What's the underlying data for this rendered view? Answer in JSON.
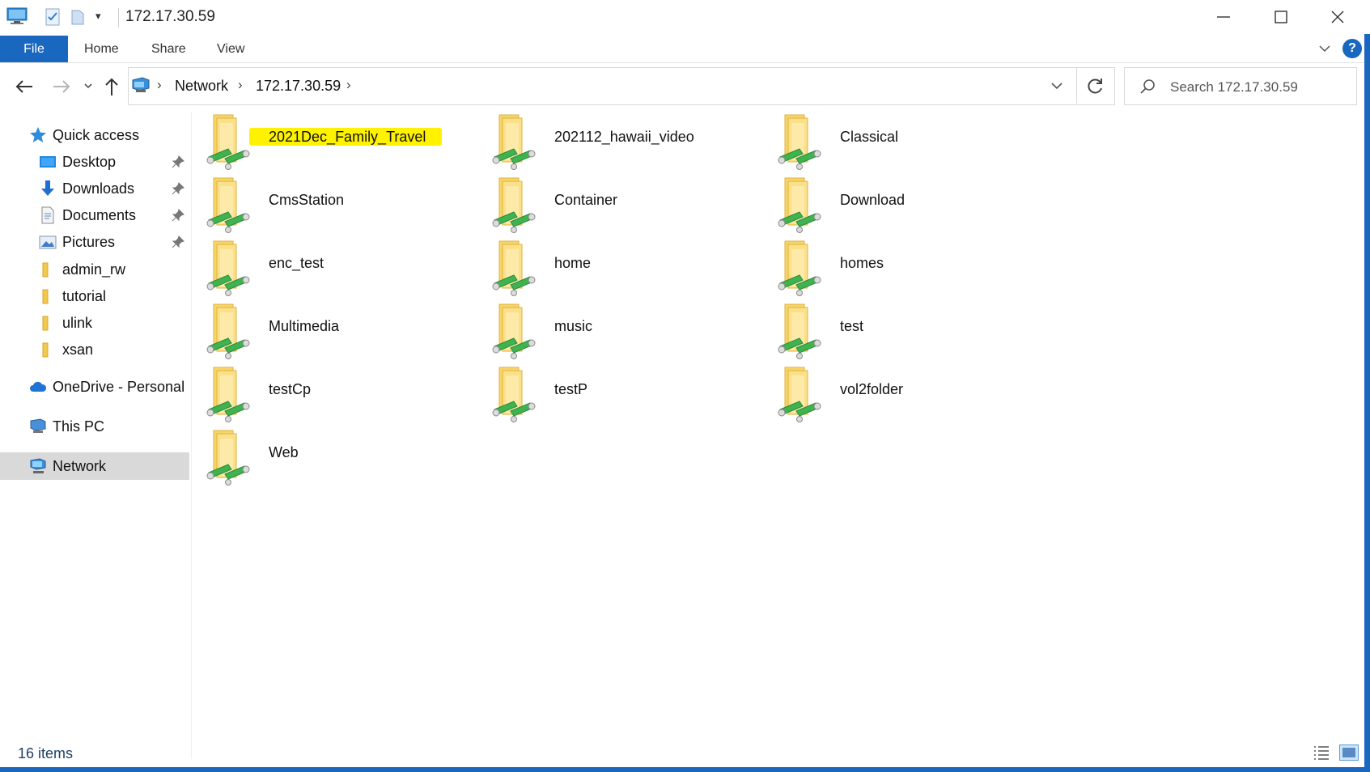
{
  "window": {
    "title": "172.17.30.59",
    "minimize_icon": "minimize-icon",
    "maximize_icon": "maximize-icon",
    "close_icon": "close-icon"
  },
  "ribbon": {
    "tabs": [
      "File",
      "Home",
      "Share",
      "View"
    ],
    "active_tab": "File",
    "help_label": "?"
  },
  "addressbar": {
    "breadcrumbs": [
      "Network",
      "172.17.30.59"
    ],
    "refresh_icon": "refresh-icon"
  },
  "search": {
    "placeholder": "Search 172.17.30.59"
  },
  "sidebar": {
    "quick_access": {
      "label": "Quick access",
      "icon": "star-icon"
    },
    "pinned": [
      {
        "label": "Desktop",
        "icon": "desktop-icon"
      },
      {
        "label": "Downloads",
        "icon": "download-arrow-icon"
      },
      {
        "label": "Documents",
        "icon": "document-icon"
      },
      {
        "label": "Pictures",
        "icon": "picture-icon"
      }
    ],
    "folders": [
      "admin_rw",
      "tutorial",
      "ulink",
      "xsan"
    ],
    "onedrive": {
      "label": "OneDrive - Personal",
      "icon": "cloud-icon"
    },
    "this_pc": {
      "label": "This PC",
      "icon": "computer-icon"
    },
    "network": {
      "label": "Network",
      "icon": "network-icon",
      "selected": true
    }
  },
  "content": {
    "items": [
      "2021Dec_Family_Travel",
      "202112_hawaii_video",
      "Classical",
      "CmsStation",
      "Container",
      "Download",
      "enc_test",
      "home",
      "homes",
      "Multimedia",
      "music",
      "test",
      "testCp",
      "testP",
      "vol2folder",
      "Web"
    ],
    "highlighted_item": "2021Dec_Family_Travel",
    "highlight_color": "#fff200",
    "item_icon": "shared-folder-icon"
  },
  "status": {
    "item_count": "16 items"
  },
  "colors": {
    "accent": "#1a67c0",
    "selection": "#d9d9d9"
  }
}
